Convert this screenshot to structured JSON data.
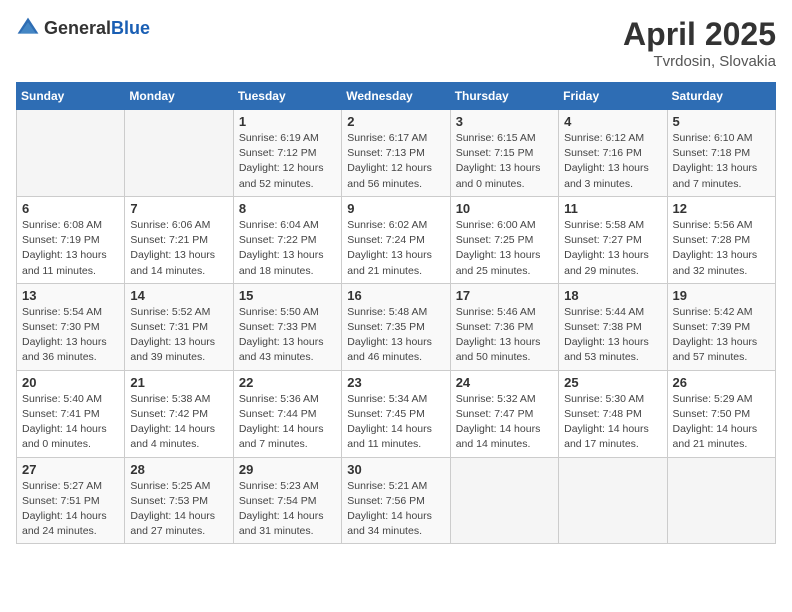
{
  "header": {
    "logo_general": "General",
    "logo_blue": "Blue",
    "title": "April 2025",
    "location": "Tvrdosin, Slovakia"
  },
  "days_of_week": [
    "Sunday",
    "Monday",
    "Tuesday",
    "Wednesday",
    "Thursday",
    "Friday",
    "Saturday"
  ],
  "weeks": [
    [
      {
        "day": "",
        "info": ""
      },
      {
        "day": "",
        "info": ""
      },
      {
        "day": "1",
        "info": "Sunrise: 6:19 AM\nSunset: 7:12 PM\nDaylight: 12 hours and 52 minutes."
      },
      {
        "day": "2",
        "info": "Sunrise: 6:17 AM\nSunset: 7:13 PM\nDaylight: 12 hours and 56 minutes."
      },
      {
        "day": "3",
        "info": "Sunrise: 6:15 AM\nSunset: 7:15 PM\nDaylight: 13 hours and 0 minutes."
      },
      {
        "day": "4",
        "info": "Sunrise: 6:12 AM\nSunset: 7:16 PM\nDaylight: 13 hours and 3 minutes."
      },
      {
        "day": "5",
        "info": "Sunrise: 6:10 AM\nSunset: 7:18 PM\nDaylight: 13 hours and 7 minutes."
      }
    ],
    [
      {
        "day": "6",
        "info": "Sunrise: 6:08 AM\nSunset: 7:19 PM\nDaylight: 13 hours and 11 minutes."
      },
      {
        "day": "7",
        "info": "Sunrise: 6:06 AM\nSunset: 7:21 PM\nDaylight: 13 hours and 14 minutes."
      },
      {
        "day": "8",
        "info": "Sunrise: 6:04 AM\nSunset: 7:22 PM\nDaylight: 13 hours and 18 minutes."
      },
      {
        "day": "9",
        "info": "Sunrise: 6:02 AM\nSunset: 7:24 PM\nDaylight: 13 hours and 21 minutes."
      },
      {
        "day": "10",
        "info": "Sunrise: 6:00 AM\nSunset: 7:25 PM\nDaylight: 13 hours and 25 minutes."
      },
      {
        "day": "11",
        "info": "Sunrise: 5:58 AM\nSunset: 7:27 PM\nDaylight: 13 hours and 29 minutes."
      },
      {
        "day": "12",
        "info": "Sunrise: 5:56 AM\nSunset: 7:28 PM\nDaylight: 13 hours and 32 minutes."
      }
    ],
    [
      {
        "day": "13",
        "info": "Sunrise: 5:54 AM\nSunset: 7:30 PM\nDaylight: 13 hours and 36 minutes."
      },
      {
        "day": "14",
        "info": "Sunrise: 5:52 AM\nSunset: 7:31 PM\nDaylight: 13 hours and 39 minutes."
      },
      {
        "day": "15",
        "info": "Sunrise: 5:50 AM\nSunset: 7:33 PM\nDaylight: 13 hours and 43 minutes."
      },
      {
        "day": "16",
        "info": "Sunrise: 5:48 AM\nSunset: 7:35 PM\nDaylight: 13 hours and 46 minutes."
      },
      {
        "day": "17",
        "info": "Sunrise: 5:46 AM\nSunset: 7:36 PM\nDaylight: 13 hours and 50 minutes."
      },
      {
        "day": "18",
        "info": "Sunrise: 5:44 AM\nSunset: 7:38 PM\nDaylight: 13 hours and 53 minutes."
      },
      {
        "day": "19",
        "info": "Sunrise: 5:42 AM\nSunset: 7:39 PM\nDaylight: 13 hours and 57 minutes."
      }
    ],
    [
      {
        "day": "20",
        "info": "Sunrise: 5:40 AM\nSunset: 7:41 PM\nDaylight: 14 hours and 0 minutes."
      },
      {
        "day": "21",
        "info": "Sunrise: 5:38 AM\nSunset: 7:42 PM\nDaylight: 14 hours and 4 minutes."
      },
      {
        "day": "22",
        "info": "Sunrise: 5:36 AM\nSunset: 7:44 PM\nDaylight: 14 hours and 7 minutes."
      },
      {
        "day": "23",
        "info": "Sunrise: 5:34 AM\nSunset: 7:45 PM\nDaylight: 14 hours and 11 minutes."
      },
      {
        "day": "24",
        "info": "Sunrise: 5:32 AM\nSunset: 7:47 PM\nDaylight: 14 hours and 14 minutes."
      },
      {
        "day": "25",
        "info": "Sunrise: 5:30 AM\nSunset: 7:48 PM\nDaylight: 14 hours and 17 minutes."
      },
      {
        "day": "26",
        "info": "Sunrise: 5:29 AM\nSunset: 7:50 PM\nDaylight: 14 hours and 21 minutes."
      }
    ],
    [
      {
        "day": "27",
        "info": "Sunrise: 5:27 AM\nSunset: 7:51 PM\nDaylight: 14 hours and 24 minutes."
      },
      {
        "day": "28",
        "info": "Sunrise: 5:25 AM\nSunset: 7:53 PM\nDaylight: 14 hours and 27 minutes."
      },
      {
        "day": "29",
        "info": "Sunrise: 5:23 AM\nSunset: 7:54 PM\nDaylight: 14 hours and 31 minutes."
      },
      {
        "day": "30",
        "info": "Sunrise: 5:21 AM\nSunset: 7:56 PM\nDaylight: 14 hours and 34 minutes."
      },
      {
        "day": "",
        "info": ""
      },
      {
        "day": "",
        "info": ""
      },
      {
        "day": "",
        "info": ""
      }
    ]
  ]
}
